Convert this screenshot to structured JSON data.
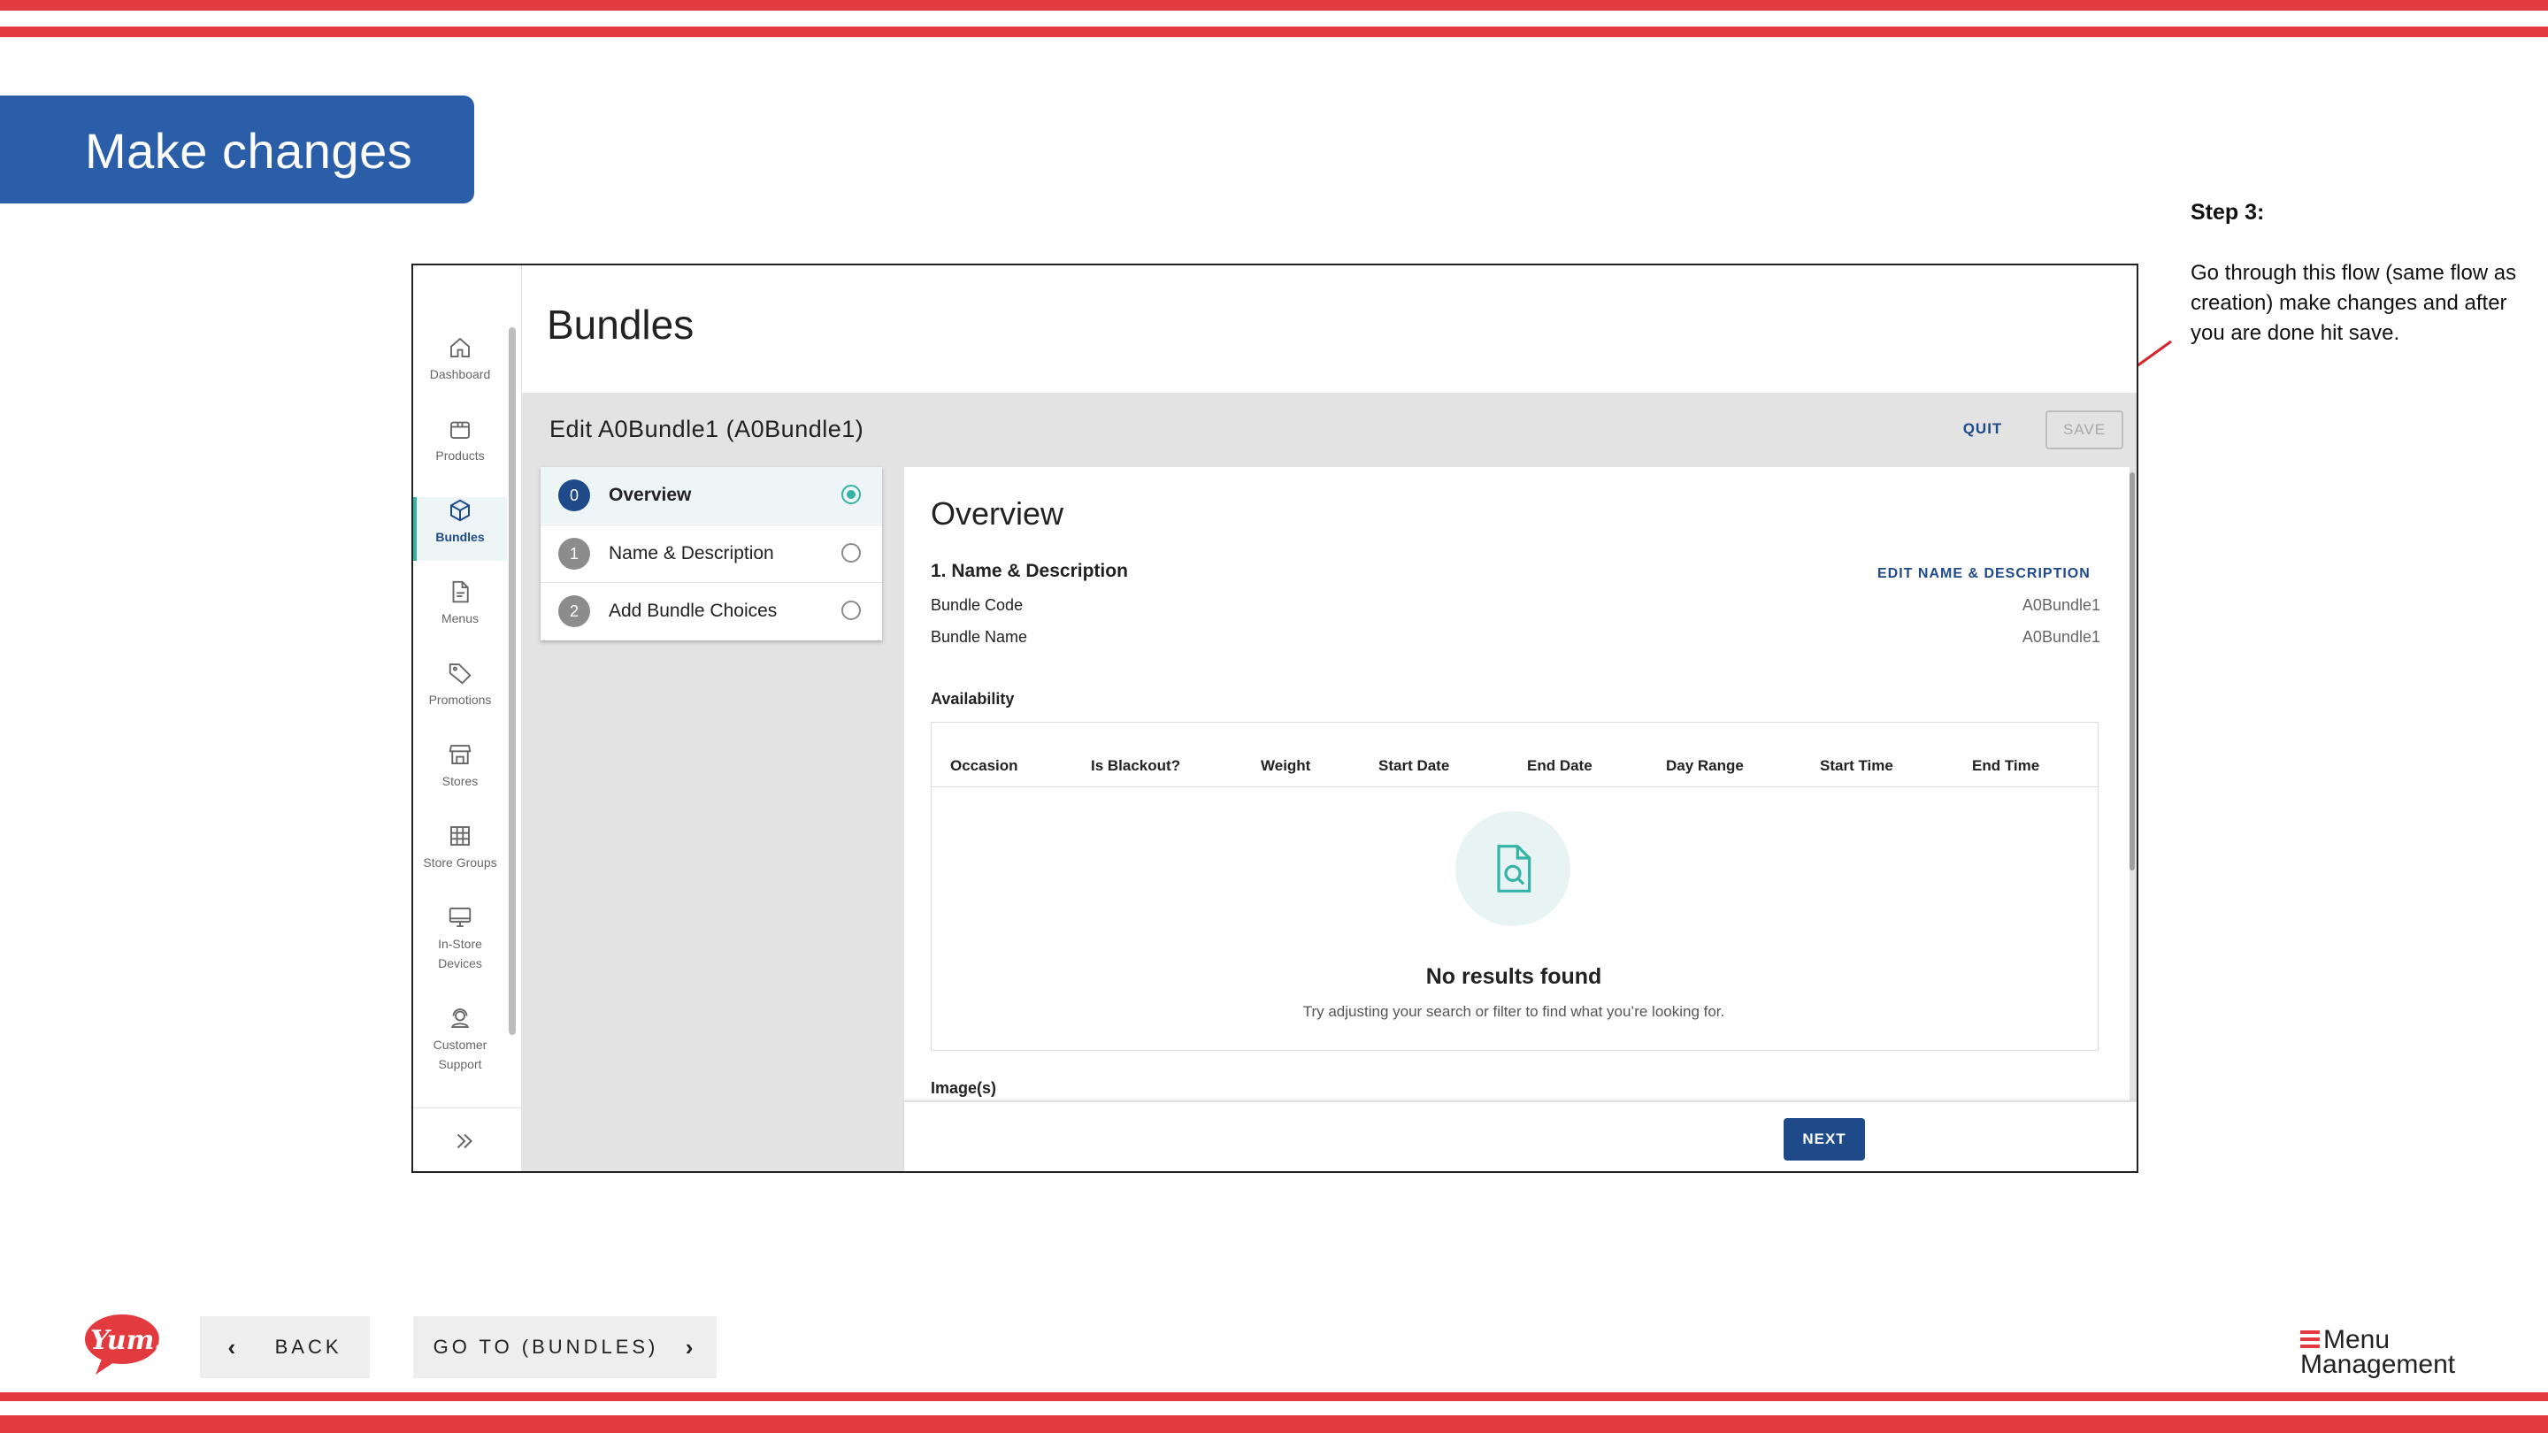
{
  "slide": {
    "banner_title": "Make changes",
    "step_title": "Step 3:",
    "step_text": "Go through this flow (same flow as creation) make changes and after you are done hit save.",
    "accent_red": "#e23a3f",
    "banner_blue": "#2a5ea8"
  },
  "sidebar": {
    "items": [
      {
        "label": "Dashboard",
        "icon": "home-icon"
      },
      {
        "label": "Products",
        "icon": "box-icon"
      },
      {
        "label": "Bundles",
        "icon": "cube-icon",
        "active": true
      },
      {
        "label": "Menus",
        "icon": "document-icon"
      },
      {
        "label": "Promotions",
        "icon": "tag-icon"
      },
      {
        "label": "Stores",
        "icon": "store-icon"
      },
      {
        "label": "Store Groups",
        "icon": "grid-icon"
      },
      {
        "label": "In-Store Devices",
        "label_line1": "In-Store",
        "label_line2": "Devices",
        "icon": "monitor-icon"
      },
      {
        "label": "Customer Support",
        "label_line1": "Customer",
        "label_line2": "Support",
        "icon": "support-icon"
      }
    ],
    "expand_icon": "double-chevron-right-icon"
  },
  "page": {
    "title": "Bundles",
    "edit_title": "Edit A0Bundle1 (A0Bundle1)",
    "quit_label": "QUIT",
    "save_label": "SAVE"
  },
  "stepper": {
    "steps": [
      {
        "number": "0",
        "label": "Overview",
        "active": true
      },
      {
        "number": "1",
        "label": "Name & Description",
        "active": false
      },
      {
        "number": "2",
        "label": "Add Bundle Choices",
        "active": false
      }
    ]
  },
  "overview": {
    "title": "Overview",
    "section1_title": "1. Name & Description",
    "edit_link": "EDIT NAME & DESCRIPTION",
    "fields": [
      {
        "label": "Bundle Code",
        "value": "A0Bundle1"
      },
      {
        "label": "Bundle Name",
        "value": "A0Bundle1"
      }
    ],
    "availability_title": "Availability",
    "table_headers": [
      "Occasion",
      "Is Blackout?",
      "Weight",
      "Start Date",
      "End Date",
      "Day Range",
      "Start Time",
      "End Time"
    ],
    "empty_title": "No results found",
    "empty_subtitle": "Try adjusting your search or filter to find what you’re looking for.",
    "images_label": "Image(s)",
    "next_label": "NEXT",
    "accent_teal": "#35b3a7",
    "primary_blue": "#1f4a8a"
  },
  "bottom_nav": {
    "back_label": "BACK",
    "goto_label": "GO TO (BUNDLES)"
  },
  "logos": {
    "yum_text": "Yum!",
    "mm_line1": "Menu",
    "mm_line2": "Management"
  }
}
